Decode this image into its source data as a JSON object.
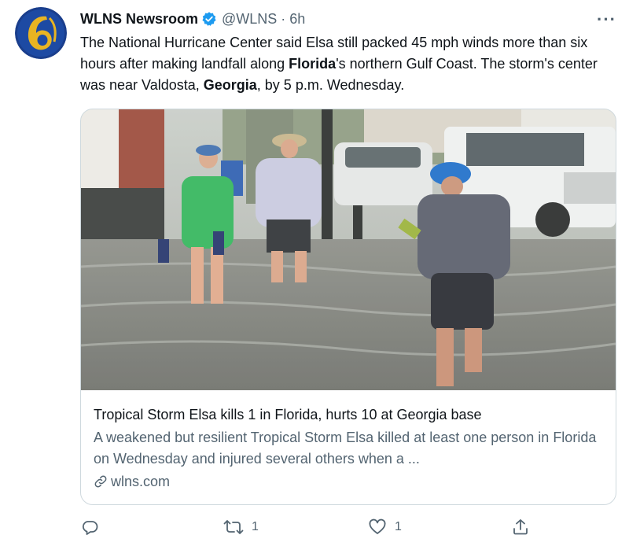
{
  "tweet": {
    "author_name": "WLNS Newsroom",
    "handle": "@WLNS",
    "separator": "·",
    "time": "6h",
    "more_label": "···",
    "text_segments": [
      {
        "text": "The National Hurricane Center said Elsa still packed 45 mph winds more than six hours after making landfall along ",
        "bold": false
      },
      {
        "text": "Florida",
        "bold": true
      },
      {
        "text": "'s northern Gulf Coast. The storm's center was near Valdosta, ",
        "bold": false
      },
      {
        "text": "Georgia",
        "bold": true
      },
      {
        "text": ", by 5 p.m. Wednesday.",
        "bold": false
      }
    ]
  },
  "card": {
    "image_alt": "People wading through a flooded street in heavy rain",
    "title": "Tropical Storm Elsa kills 1 in Florida, hurts 10 at Georgia base",
    "description": "A weakened but resilient Tropical Storm Elsa killed at least one person in Florida on Wednesday and injured several others when a ...",
    "domain": "wlns.com"
  },
  "actions": {
    "reply_count": "",
    "retweet_count": "1",
    "like_count": "1"
  },
  "icons": [
    "logo-6-icon",
    "verified-icon",
    "more-icon",
    "link-icon",
    "reply-icon",
    "retweet-icon",
    "like-icon",
    "share-icon"
  ],
  "colors": {
    "verified": "#1d9bf0",
    "text": "#0f1419",
    "secondary": "#536471",
    "border": "#cfd9de",
    "logo_blue": "#1a3e8c",
    "logo_gold": "#e8b422"
  }
}
